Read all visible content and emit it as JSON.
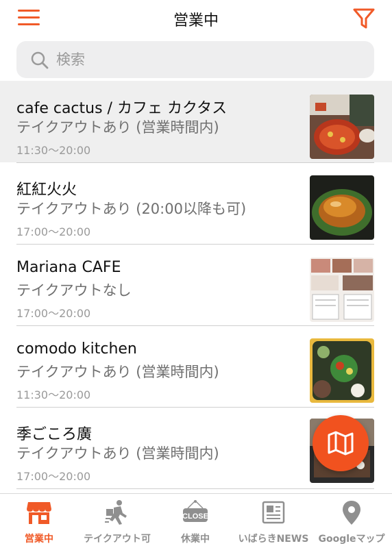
{
  "header": {
    "title": "営業中",
    "menu_icon": "hamburger-menu-icon",
    "filter_icon": "filter-icon"
  },
  "search": {
    "placeholder": "検索",
    "value": ""
  },
  "shops": [
    {
      "name": "cafe cactus / カフェ カクタス",
      "takeout": "テイクアウトあり (営業時間内)",
      "hours": "11:30〜20:00",
      "selected": true
    },
    {
      "name": "紅紅火火",
      "takeout": "テイクアウトあり (20:00以降も可)",
      "hours": "17:00〜20:00",
      "selected": false
    },
    {
      "name": "Mariana CAFE",
      "takeout": "テイクアウトなし",
      "hours": "17:00〜20:00",
      "selected": false
    },
    {
      "name": "comodo kitchen",
      "takeout": "テイクアウトあり (営業時間内)",
      "hours": "11:30〜20:00",
      "selected": false
    },
    {
      "name": "季ごころ廣",
      "takeout": "テイクアウトあり (営業時間内)",
      "hours": "17:00〜20:00",
      "selected": false
    }
  ],
  "fab": {
    "icon": "folded-map-icon"
  },
  "tabs": [
    {
      "label": "営業中",
      "icon": "storefront-icon",
      "active": true
    },
    {
      "label": "テイクアウト可",
      "icon": "takeout-runner-icon",
      "active": false
    },
    {
      "label": "休業中",
      "icon": "close-sign-icon",
      "active": false,
      "sign_text": "CLOSE"
    },
    {
      "label": "いばらきNEWS",
      "icon": "newspaper-icon",
      "active": false
    },
    {
      "label": "Googleマップ",
      "icon": "map-pin-icon",
      "active": false
    }
  ],
  "colors": {
    "accent": "#f05a28",
    "fab": "#f1521f",
    "inactive": "#8f8f8f",
    "selected_row": "#efefef"
  }
}
